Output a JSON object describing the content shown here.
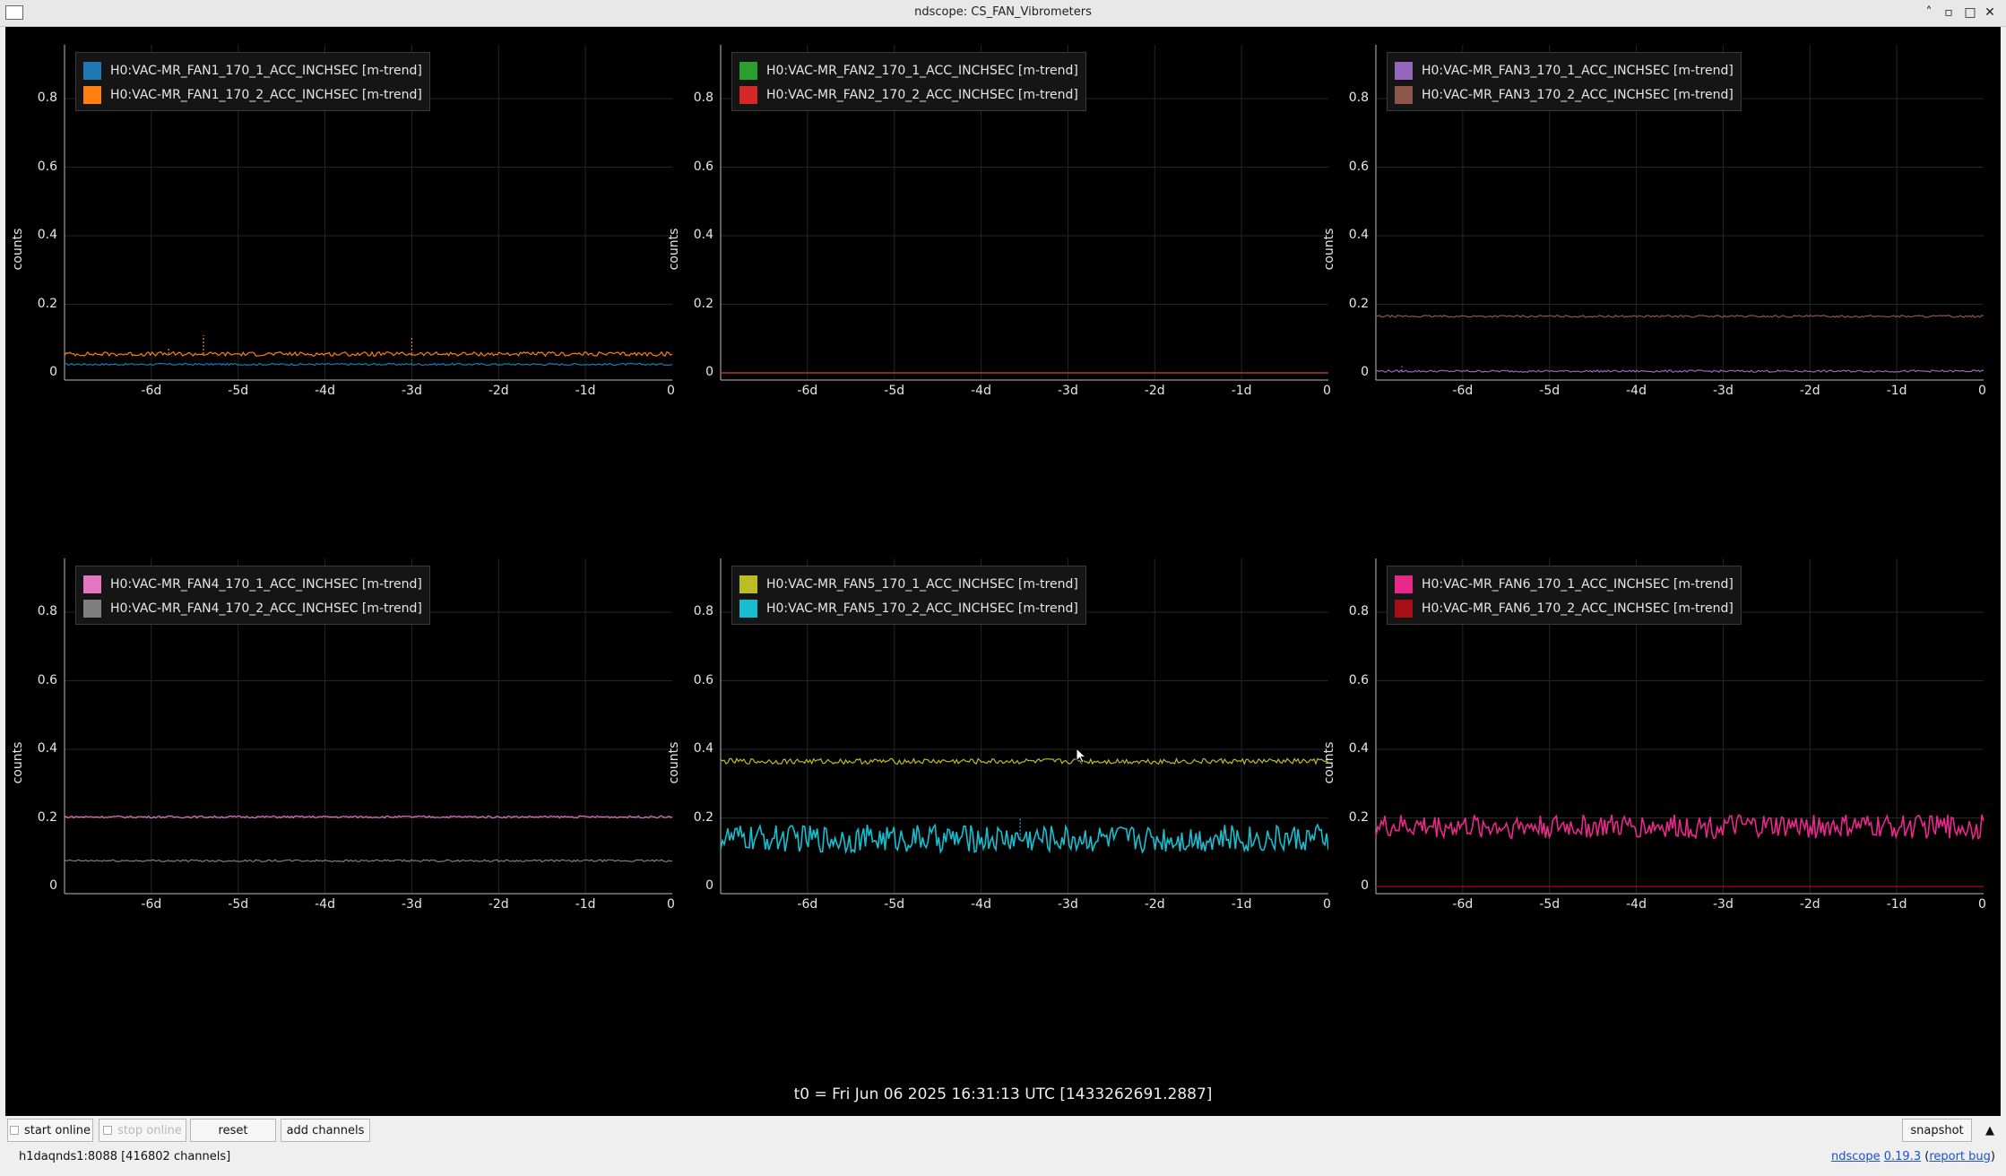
{
  "window": {
    "title": "ndscope: CS_FAN_Vibrometers",
    "min_glyph": "˄",
    "max_glyph": "▫",
    "restore_glyph": "□",
    "close_glyph": "✕"
  },
  "axes": {
    "ylabel": "counts",
    "yticks": [
      "0",
      "0.2",
      "0.4",
      "0.6",
      "0.8"
    ],
    "xticks": [
      "-6d",
      "-5d",
      "-4d",
      "-3d",
      "-2d",
      "-1d",
      "0"
    ]
  },
  "plots": [
    {
      "series": [
        {
          "name": "H0:VAC-MR_FAN1_170_1_ACC_INCHSEC [m-trend]",
          "color": "#1f77b4",
          "level": 0.025,
          "noise": 0.003,
          "spikes": [
            {
              "x": -3.0,
              "v": 0.04
            }
          ]
        },
        {
          "name": "H0:VAC-MR_FAN1_170_2_ACC_INCHSEC [m-trend]",
          "color": "#ff7f0e",
          "level": 0.055,
          "noise": 0.006,
          "spikes": [
            {
              "x": -5.4,
              "v": 0.11
            },
            {
              "x": -3.0,
              "v": 0.105
            },
            {
              "x": -5.8,
              "v": 0.075
            }
          ]
        }
      ]
    },
    {
      "series": [
        {
          "name": "H0:VAC-MR_FAN2_170_1_ACC_INCHSEC [m-trend]",
          "color": "#2ca02c",
          "level": 0.0,
          "noise": 0.0,
          "spikes": []
        },
        {
          "name": "H0:VAC-MR_FAN2_170_2_ACC_INCHSEC [m-trend]",
          "color": "#d62728",
          "level": 0.0,
          "noise": 0.0,
          "spikes": []
        }
      ]
    },
    {
      "series": [
        {
          "name": "H0:VAC-MR_FAN3_170_1_ACC_INCHSEC [m-trend]",
          "color": "#9467bd",
          "level": 0.005,
          "noise": 0.003,
          "spikes": [
            {
              "x": -6.7,
              "v": 0.02
            }
          ]
        },
        {
          "name": "H0:VAC-MR_FAN3_170_2_ACC_INCHSEC [m-trend]",
          "color": "#8c564b",
          "level": 0.165,
          "noise": 0.003,
          "spikes": []
        }
      ]
    },
    {
      "series": [
        {
          "name": "H0:VAC-MR_FAN4_170_1_ACC_INCHSEC [m-trend]",
          "color": "#e377c2",
          "level": 0.203,
          "noise": 0.003,
          "spikes": []
        },
        {
          "name": "H0:VAC-MR_FAN4_170_2_ACC_INCHSEC [m-trend]",
          "color": "#7f7f7f",
          "level": 0.075,
          "noise": 0.003,
          "spikes": []
        }
      ]
    },
    {
      "series": [
        {
          "name": "H0:VAC-MR_FAN5_170_1_ACC_INCHSEC [m-trend]",
          "color": "#bcbd22",
          "level": 0.365,
          "noise": 0.008,
          "spikes": []
        },
        {
          "name": "H0:VAC-MR_FAN5_170_2_ACC_INCHSEC [m-trend]",
          "color": "#17becf",
          "level": 0.14,
          "noise": 0.04,
          "spikes": [
            {
              "x": -3.55,
              "v": 0.2
            }
          ]
        }
      ]
    },
    {
      "series": [
        {
          "name": "H0:VAC-MR_FAN6_170_1_ACC_INCHSEC [m-trend]",
          "color": "#e7298a",
          "level": 0.175,
          "noise": 0.035,
          "spikes": []
        },
        {
          "name": "H0:VAC-MR_FAN6_170_2_ACC_INCHSEC [m-trend]",
          "color": "#a50f15",
          "level": 0.0,
          "noise": 0.0,
          "spikes": []
        }
      ]
    }
  ],
  "t0": "t0 = Fri Jun 06 2025 16:31:13 UTC [1433262691.2887]",
  "buttons": {
    "start_online": "start online",
    "stop_online": "stop online",
    "reset": "reset",
    "add_channels": "add channels",
    "snapshot": "snapshot",
    "expand": "▲"
  },
  "status": {
    "server": "h1daqnds1:8088  [416802 channels]",
    "app_link": "ndscope",
    "version_link": "0.19.3",
    "open_paren": " (",
    "report_link": "report bug",
    "close_paren": ")"
  }
}
